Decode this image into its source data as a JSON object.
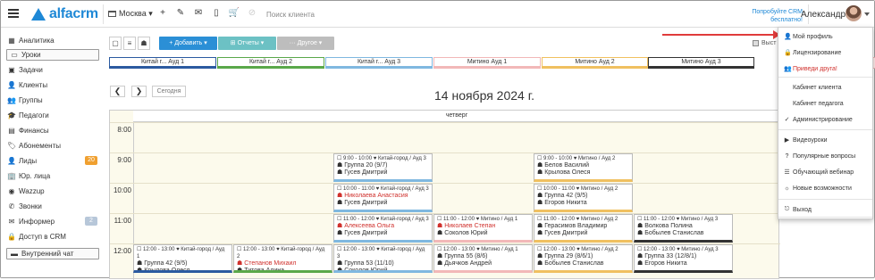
{
  "app": {
    "logo_text": "alfacrm",
    "city": "Москва ▾",
    "search_placeholder": "Поиск клиента",
    "promo": "Попробуйте CRM бесплатно!",
    "user": "Александра"
  },
  "toolbar_icons": [
    "+",
    "✎",
    "✉",
    "▯",
    "🛒",
    "⊘"
  ],
  "sidebar": {
    "items": [
      {
        "label": "Аналитика",
        "icon": "chart-icon",
        "glyph": "▦"
      },
      {
        "label": "Уроки",
        "icon": "lessons-icon",
        "glyph": "▭"
      },
      {
        "label": "Задачи",
        "icon": "tasks-icon",
        "glyph": "▣"
      },
      {
        "label": "Клиенты",
        "icon": "user-icon",
        "glyph": "👤"
      },
      {
        "label": "Группы",
        "icon": "groups-icon",
        "glyph": "👥"
      },
      {
        "label": "Педагоги",
        "icon": "teacher-icon",
        "glyph": "🎓"
      },
      {
        "label": "Финансы",
        "icon": "finance-icon",
        "glyph": "▤"
      },
      {
        "label": "Абонементы",
        "icon": "tag-icon",
        "glyph": "🏷"
      },
      {
        "label": "Лиды",
        "icon": "leads-icon",
        "glyph": "👤",
        "badge": "20"
      },
      {
        "label": "Юр. лица",
        "icon": "building-icon",
        "glyph": "🏢"
      },
      {
        "label": "Wazzup",
        "icon": "chat-icon",
        "glyph": "◉"
      },
      {
        "label": "Звонки",
        "icon": "phone-icon",
        "glyph": "✆"
      },
      {
        "label": "Информер",
        "icon": "informer-icon",
        "glyph": "✉",
        "badge": "2"
      },
      {
        "label": "Доступ в CRM",
        "icon": "lock-icon",
        "glyph": "🔒"
      },
      {
        "label": "Внутренний чат",
        "icon": "internal-chat-icon",
        "glyph": "▬"
      }
    ]
  },
  "main": {
    "add_button": "+ Добавить ▾",
    "reports_button": "⊞ Отчеты ▾",
    "other_button": "··· Другое ▾",
    "checkbox_label": "Выст",
    "rooms": [
      "Китай г... Ауд 1",
      "Китай г... Ауд 2",
      "Китай г... Ауд 3",
      "Митино Ауд 1",
      "Митино Ауд 2",
      "Митино Ауд 3"
    ],
    "room_colors": [
      "#2b5aa0",
      "#5aa84a",
      "#7fb8e0",
      "#f2b8b8",
      "#f0c060",
      "#333333"
    ],
    "today_button": "Сегодня",
    "date": "14 ноября 2024 г.",
    "day": "четверг",
    "hours": [
      "8:00",
      "9:00",
      "10:00",
      "11:00",
      "12:00"
    ]
  },
  "lessons": [
    {
      "meta": "☐ 9:00 - 10:00 ♥ Китай-город / Ауд 3",
      "group": "☗ Группа 20 (9/7)",
      "teacher": "☗ Гусев Дмитрий",
      "red": false
    },
    {
      "meta": "☐ 9:00 - 10:00 ♥ Митино / Ауд 2",
      "group": "☗ Белов Василий",
      "teacher": "☗ Крылова Олеся",
      "red": false
    },
    {
      "meta": "☐ 10:00 - 11:00 ♥ Китай-город / Ауд 3",
      "group": "☗ Николаева Анастасия",
      "teacher": "☗ Гусев Дмитрий",
      "red": true
    },
    {
      "meta": "☐ 10:00 - 11:00 ♥ Митино / Ауд 2",
      "group": "☗ Группа 42 (9/5)",
      "teacher": "☗ Егоров Никита",
      "red": false
    },
    {
      "meta": "☐ 11:00 - 12:00 ♥ Китай-город / Ауд 3",
      "group": "☗ Алексеева Ольга",
      "teacher": "☗ Гусев Дмитрий",
      "red": true
    },
    {
      "meta": "☐ 11:00 - 12:00 ♥ Митино / Ауд 1",
      "group": "☗ Николаев Степан",
      "teacher": "☗ Соколов Юрий",
      "red": true
    },
    {
      "meta": "☐ 11:00 - 12:00 ♥ Митино / Ауд 2",
      "group": "☗ Герасимов Владимир",
      "teacher": "☗ Гусев Дмитрий",
      "red": false
    },
    {
      "meta": "☐ 11:00 - 12:00 ♥ Митино / Ауд 3",
      "group": "☗ Волкова Полина",
      "teacher": "☗ Бобылев Станислав",
      "red": false
    },
    {
      "meta": "☐ 12:00 - 13:00 ♥ Китай-город / Ауд 1",
      "group": "☗ Группа 42 (9/5)",
      "teacher": "☗ Крылова Олеся",
      "red": false
    },
    {
      "meta": "☐ 12:00 - 13:00 ♥ Китай-город / Ауд 2",
      "group": "☗ Степанов Михаил",
      "teacher": "☗ Титова Алина",
      "red": true
    },
    {
      "meta": "☐ 12:00 - 13:00 ♥ Китай-город / Ауд 3",
      "group": "☗ Группа 53 (11/10)",
      "teacher": "☗ Соколов Юрий",
      "red": false
    },
    {
      "meta": "☐ 12:00 - 13:00 ♥ Митино / Ауд 1",
      "group": "☗ Группа 55 (8/6)",
      "teacher": "☗ Дьячков Андрей",
      "red": false
    },
    {
      "meta": "☐ 12:00 - 13:00 ♥ Митино / Ауд 2",
      "group": "☗ Группа 29 (8/6/1)",
      "teacher": "☗ Бобылев Станислав",
      "red": false
    },
    {
      "meta": "☐ 12:00 - 13:00 ♥ Митино / Ауд 3",
      "group": "☗ Группа 33 (12/8/1)",
      "teacher": "☗ Егоров Никита",
      "red": false
    }
  ],
  "user_menu": {
    "items": [
      {
        "label": "Мой профиль",
        "glyph": "👤",
        "icon": "profile-icon"
      },
      {
        "label": "Лицензирование",
        "glyph": "🔒",
        "icon": "license-icon"
      },
      {
        "label": "Приведи друга!",
        "glyph": "👥",
        "icon": "friends-icon",
        "red": true
      },
      {
        "label": "Кабинет клиента",
        "glyph": "",
        "icon": ""
      },
      {
        "label": "Кабинет педагога",
        "glyph": "",
        "icon": ""
      },
      {
        "label": "Администрирование",
        "glyph": "✓",
        "icon": "check-icon"
      },
      {
        "label": "Видеоуроки",
        "glyph": "▶",
        "icon": "video-icon"
      },
      {
        "label": "Популярные вопросы",
        "glyph": "?",
        "icon": "question-icon"
      },
      {
        "label": "Обучающий вебинар",
        "glyph": "☰",
        "icon": "webinar-icon"
      },
      {
        "label": "Новые возможности",
        "glyph": "☼",
        "icon": "lightbulb-icon"
      },
      {
        "label": "Выход",
        "glyph": "⎋",
        "icon": "logout-icon"
      }
    ]
  }
}
